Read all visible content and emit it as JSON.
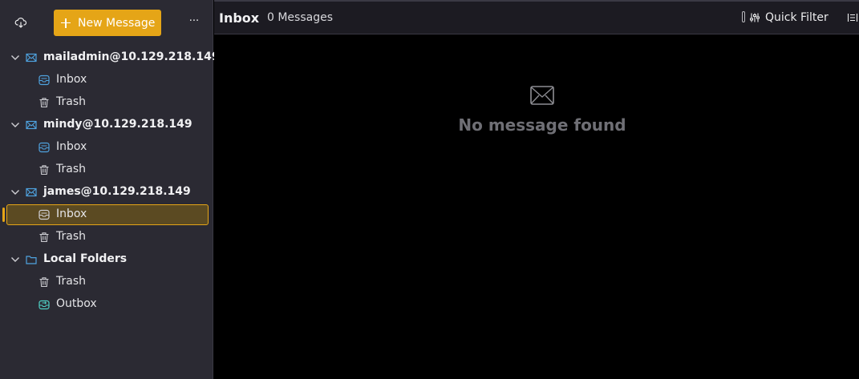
{
  "toolbar": {
    "get_messages_icon": "cloud-download-icon",
    "new_message_label": "New Message",
    "more_label": "···"
  },
  "accounts": [
    {
      "name": "mailadmin@10.129.218.149",
      "folders": [
        {
          "label": "Inbox",
          "icon": "inbox-icon"
        },
        {
          "label": "Trash",
          "icon": "trash-icon"
        }
      ]
    },
    {
      "name": "mindy@10.129.218.149",
      "folders": [
        {
          "label": "Inbox",
          "icon": "inbox-icon"
        },
        {
          "label": "Trash",
          "icon": "trash-icon"
        }
      ]
    },
    {
      "name": "james@10.129.218.149",
      "folders": [
        {
          "label": "Inbox",
          "icon": "inbox-icon",
          "selected": true
        },
        {
          "label": "Trash",
          "icon": "trash-icon"
        }
      ]
    },
    {
      "name": "Local Folders",
      "folders": [
        {
          "label": "Trash",
          "icon": "trash-icon"
        },
        {
          "label": "Outbox",
          "icon": "outbox-icon"
        }
      ]
    }
  ],
  "main": {
    "folder_title": "Inbox",
    "message_count": "0 Messages",
    "quick_filter_label": "Quick Filter",
    "empty_text": "No message found"
  },
  "colors": {
    "accent": "#e5a517",
    "sidebar_bg": "#2b2a33",
    "header_bg": "#1c1b22",
    "selected_bg": "#5b4a22",
    "account_icon": "#4fa3e0",
    "outbox_icon": "#4fd1c5"
  }
}
